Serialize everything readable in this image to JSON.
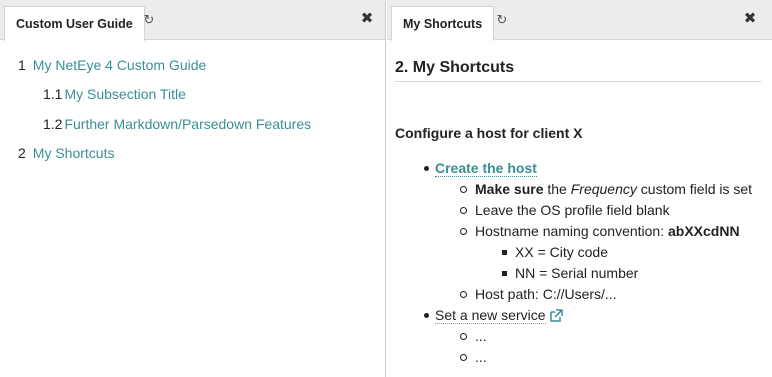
{
  "left_pane": {
    "tab_label": "Custom User Guide",
    "refresh_icon": "refresh-icon",
    "close_icon": "close-icon",
    "toc": [
      {
        "num": "1",
        "label": "My NetEye 4 Custom Guide"
      },
      {
        "num": "1.1",
        "label": "My Subsection Title"
      },
      {
        "num": "1.2",
        "label": "Further Markdown/Parsedown Features"
      },
      {
        "num": "2",
        "label": "My Shortcuts"
      }
    ]
  },
  "right_pane": {
    "tab_label": "My Shortcuts",
    "refresh_icon": "refresh-icon",
    "close_icon": "close-icon",
    "title": "2. My Shortcuts",
    "heading": "Configure a host for client X",
    "items": {
      "create_host": "Create the host",
      "make_sure_bold": "Make sure",
      "make_sure_mid": "the",
      "make_sure_italic": "Frequency",
      "make_sure_rest": "custom field is set",
      "leave_os": "Leave the OS profile field blank",
      "hostname_prefix": "Hostname naming convention:",
      "hostname_bold": "abXXcdNN",
      "xx": "XX = City code",
      "nn": "NN = Serial number",
      "host_path": "Host path: C://Users/...",
      "new_service": "Set a new service",
      "external_link_icon": "external-link-icon",
      "ellipsis_1": "...",
      "ellipsis_2": "..."
    }
  },
  "colors": {
    "link": "#3a8f96",
    "tabbar_bg": "#ececec",
    "text": "#222222"
  }
}
